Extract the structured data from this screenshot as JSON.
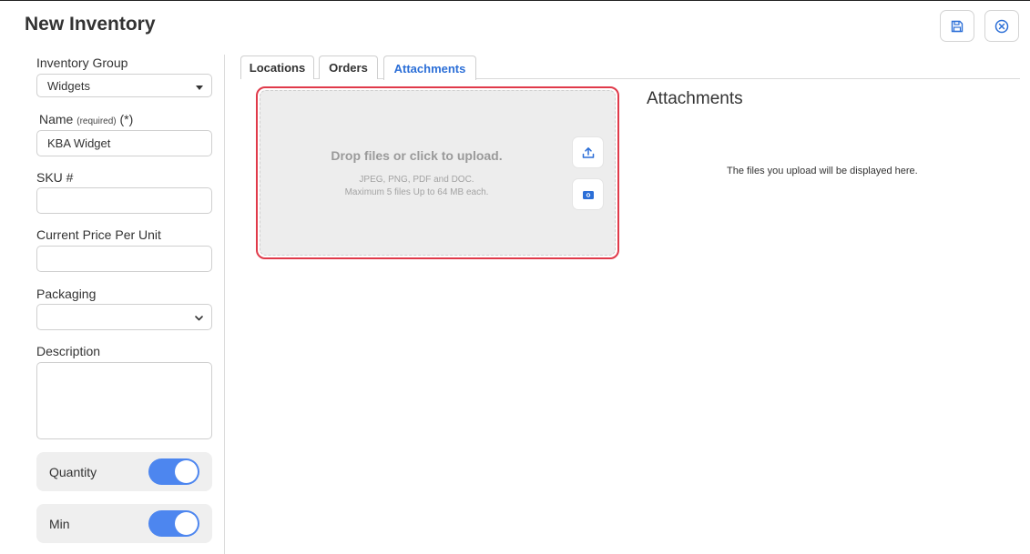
{
  "header": {
    "title": "New Inventory",
    "save_icon": "save-icon",
    "close_icon": "close-circle-icon"
  },
  "sidebar": {
    "inventory_group": {
      "label": "Inventory Group",
      "value": "Widgets"
    },
    "name": {
      "label": "Name",
      "hint": "(required)",
      "required_mark": "(*)",
      "value": "KBA Widget"
    },
    "sku": {
      "label": "SKU #",
      "value": ""
    },
    "price": {
      "label": "Current Price Per Unit",
      "value": ""
    },
    "packaging": {
      "label": "Packaging",
      "value": ""
    },
    "description": {
      "label": "Description",
      "value": ""
    },
    "toggles": [
      {
        "label": "Quantity",
        "on": true
      },
      {
        "label": "Min",
        "on": true
      }
    ]
  },
  "tabs": [
    {
      "label": "Locations",
      "active": false
    },
    {
      "label": "Orders",
      "active": false
    },
    {
      "label": "Attachments",
      "active": true
    }
  ],
  "upload": {
    "main": "Drop files or click to upload.",
    "formats": "JPEG, PNG, PDF and DOC.",
    "limits": "Maximum 5 files Up to 64 MB each.",
    "upload_icon": "upload-icon",
    "camera_icon": "camera-icon"
  },
  "attachments": {
    "title": "Attachments",
    "empty_text": "The files you upload will be displayed here."
  },
  "colors": {
    "accent": "#2c6fd7",
    "toggle_on": "#4d86ef",
    "highlight": "#e03a4a"
  }
}
